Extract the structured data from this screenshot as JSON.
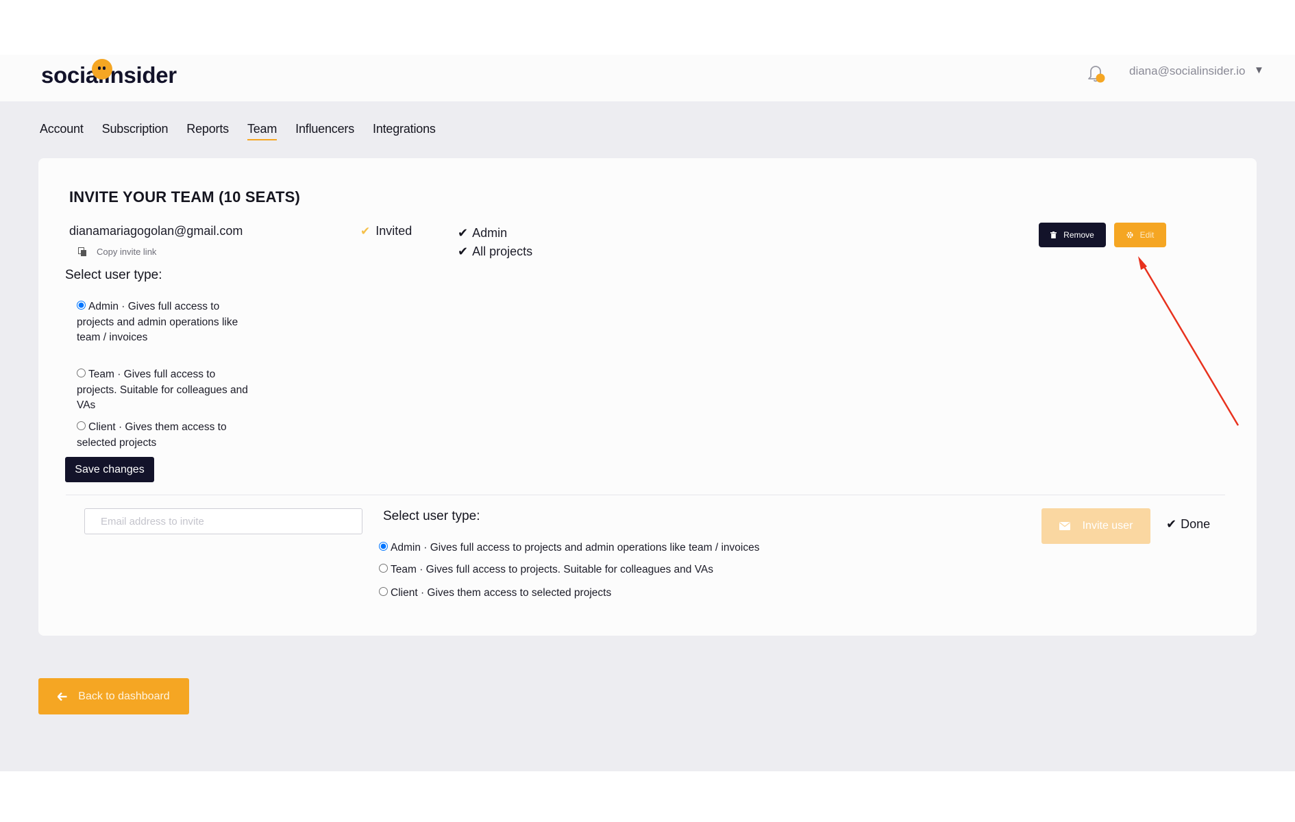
{
  "header": {
    "logo_text": "socialinsider",
    "user_email": "diana@socialinsider.io",
    "bell_icon": "bell-icon",
    "caret_icon": "caret-down-icon",
    "accent_color": "#f5a623",
    "dark_color": "#13132a"
  },
  "nav": {
    "items": [
      "Account",
      "Subscription",
      "Reports",
      "Team",
      "Influencers",
      "Integrations"
    ],
    "active": "Team"
  },
  "team": {
    "title": "INVITE YOUR TEAM (10 SEATS)",
    "member": {
      "email": "dianamariagogolan@gmail.com",
      "copy_link_label": "Copy invite link",
      "status": "Invited",
      "roles": [
        "Admin",
        "All projects"
      ],
      "remove_label": "Remove",
      "edit_label": "Edit"
    },
    "edit_form": {
      "select_label": "Select user type:",
      "options": [
        {
          "name": "Admin",
          "desc": " · Gives full access to projects and admin operations like team / invoices",
          "checked": true
        },
        {
          "name": "Team",
          "desc": " · Gives full access to projects. Suitable for colleagues and VAs",
          "checked": false
        },
        {
          "name": "Client",
          "desc": " · Gives them access to selected projects",
          "checked": false
        }
      ],
      "save_label": "Save changes"
    },
    "invite_form": {
      "email_placeholder": "Email address to invite",
      "select_label": "Select user type:",
      "options": [
        {
          "name": "Admin",
          "desc": " · Gives full access to projects and admin operations like team / invoices",
          "checked": true
        },
        {
          "name": "Team",
          "desc": " · Gives full access to projects. Suitable for colleagues and VAs",
          "checked": false
        },
        {
          "name": "Client",
          "desc": " · Gives them access to selected projects",
          "checked": false
        }
      ],
      "invite_label": "Invite user",
      "done_label": "Done"
    }
  },
  "footer": {
    "back_label": "Back to dashboard"
  }
}
